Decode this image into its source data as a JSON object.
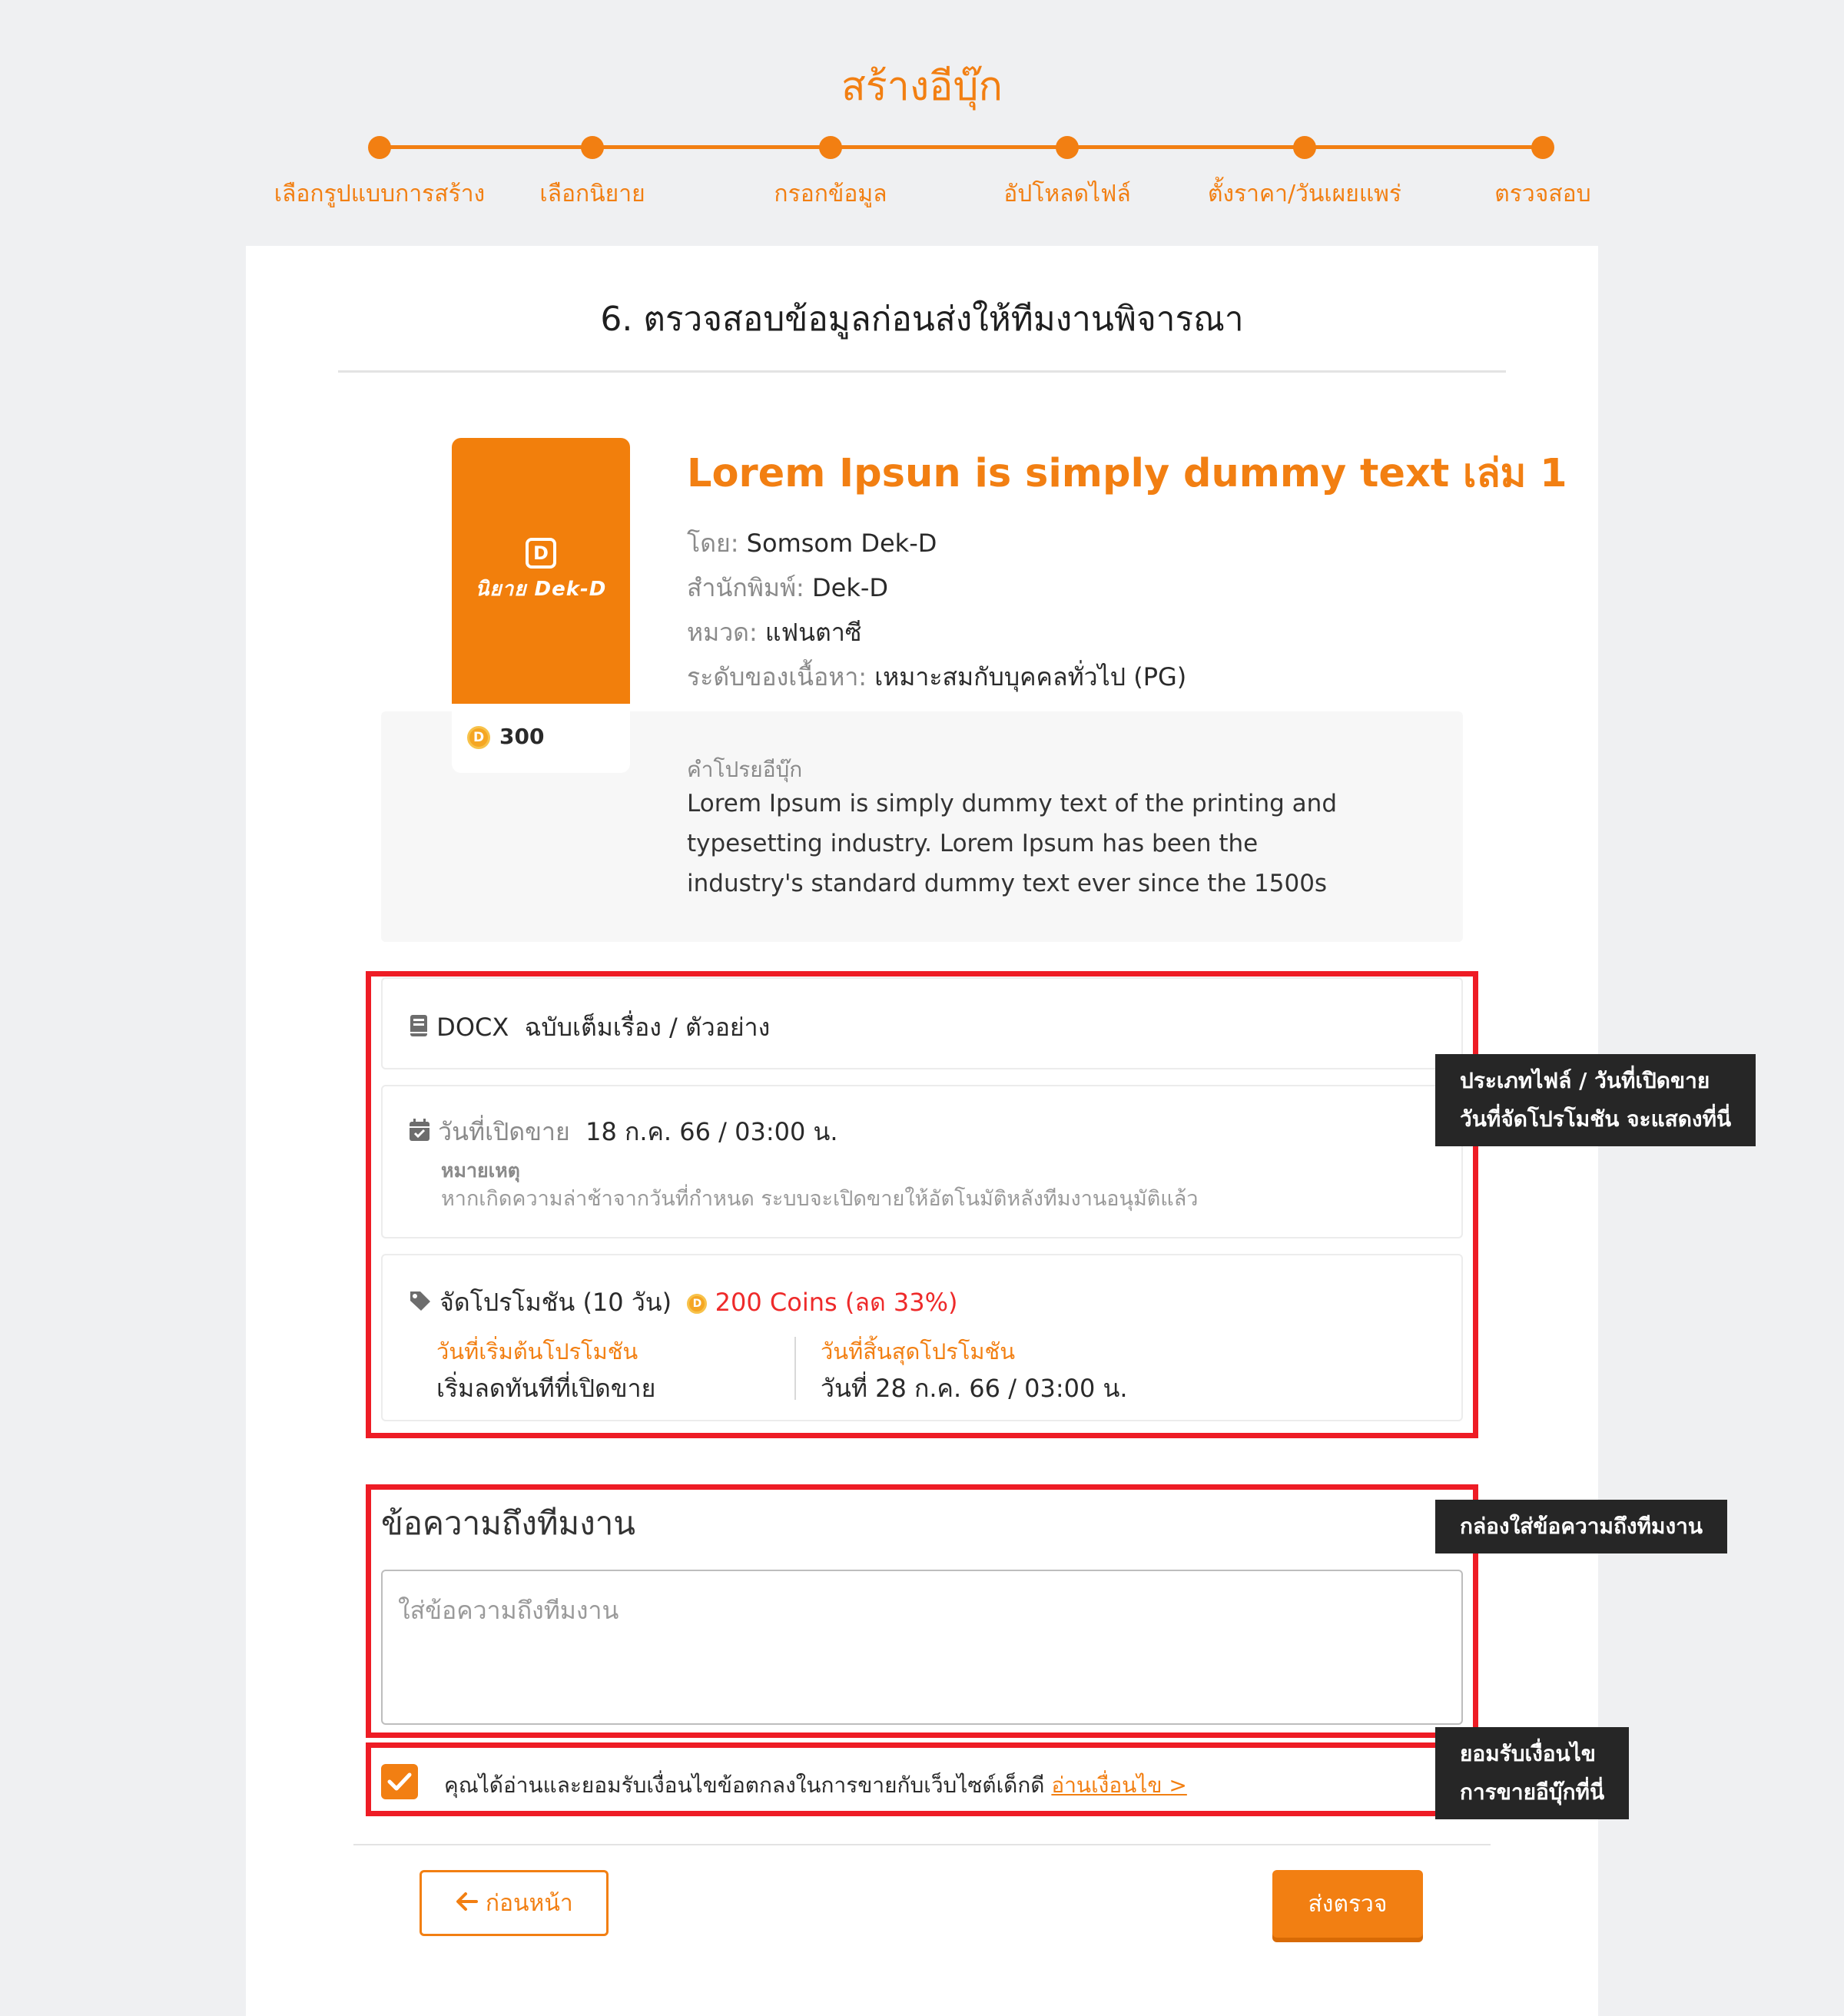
{
  "header": {
    "title": "สร้างอีบุ๊ก",
    "steps": [
      {
        "label": "เลือกรูปแบบการสร้าง"
      },
      {
        "label": "เลือกนิยาย"
      },
      {
        "label": "กรอกข้อมูล"
      },
      {
        "label": "อัปโหลดไฟล์"
      },
      {
        "label": "ตั้งราคา/วันเผยแพร่"
      },
      {
        "label": "ตรวจสอบ"
      }
    ]
  },
  "section": {
    "title": "6. ตรวจสอบข้อมูลก่อนส่งให้ทีมงานพิจารณา"
  },
  "book": {
    "title": "Lorem Ipsun is simply dummy text เล่ม 1",
    "cover_logo_text": "นิยาย Dek-D",
    "price": "300",
    "author_label": "โดย:",
    "author": "Somsom Dek-D",
    "publisher_label": "สำนักพิมพ์:",
    "publisher": "Dek-D",
    "category_label": "หมวด:",
    "category": "แฟนตาซี",
    "rating_label": "ระดับของเนื้อหา:",
    "rating": "เหมาะสมกับบุคคลทั่วไป (PG)",
    "description_label": "คำโปรยอีบุ๊ก",
    "description": "Lorem Ipsum is simply dummy text of the printing and typesetting industry. Lorem Ipsum has been the industry's standard dummy text ever since the 1500s"
  },
  "file": {
    "type": "DOCX",
    "version": "ฉบับเต็มเรื่อง / ตัวอย่าง"
  },
  "release": {
    "label": "วันที่เปิดขาย",
    "value": "18 ก.ค. 66 / 03:00 น.",
    "note_label": "หมายเหตุ",
    "note": "หากเกิดความล่าช้าจากวันที่กำหนด ระบบจะเปิดขายให้อัตโนมัติหลังทีมงานอนุมัติแล้ว"
  },
  "promotion": {
    "label": "จัดโปรโมชัน (10 วัน)",
    "price": "200 Coins (ลด 33%)",
    "start_label": "วันที่เริ่มต้นโปรโมชัน",
    "start_value": "เริ่มลดทันทีที่เปิดขาย",
    "end_label": "วันที่สิ้นสุดโปรโมชัน",
    "end_value": "วันที่ 28 ก.ค. 66 / 03:00 น."
  },
  "message": {
    "title": "ข้อความถึงทีมงาน",
    "placeholder": "ใส่ข้อความถึงทีมงาน",
    "value": ""
  },
  "agreement": {
    "checked": true,
    "text": "คุณได้อ่านและยอมรับเงื่อนไขข้อตกลงในการขายกับเว็บไซต์เด็กดี",
    "link": "อ่านเงื่อนไข >"
  },
  "buttons": {
    "back": "ก่อนหน้า",
    "submit": "ส่งตรวจ"
  },
  "callouts": {
    "file_line1": "ประเภทไฟล์ / วันที่เปิดขาย",
    "file_line2": "วันที่จัดโปรโมชัน จะแสดงที่นี่",
    "message": "กล่องใส่ข้อความถึงทีมงาน",
    "agree_line1": "ยอมรับเงื่อนไข",
    "agree_line2": "การขายอีบุ๊กที่นี่"
  },
  "colors": {
    "accent": "#f27f12",
    "highlight": "#ee1c25",
    "promo_price": "#ee2a2a",
    "callout_bg": "#262626",
    "page_bg": "#eff0f2"
  },
  "icons": {
    "file": "book-icon",
    "release": "calendar-icon",
    "promotion": "tag-icon",
    "coin": "coin-icon",
    "back": "arrow-left-icon",
    "check": "check-icon"
  }
}
